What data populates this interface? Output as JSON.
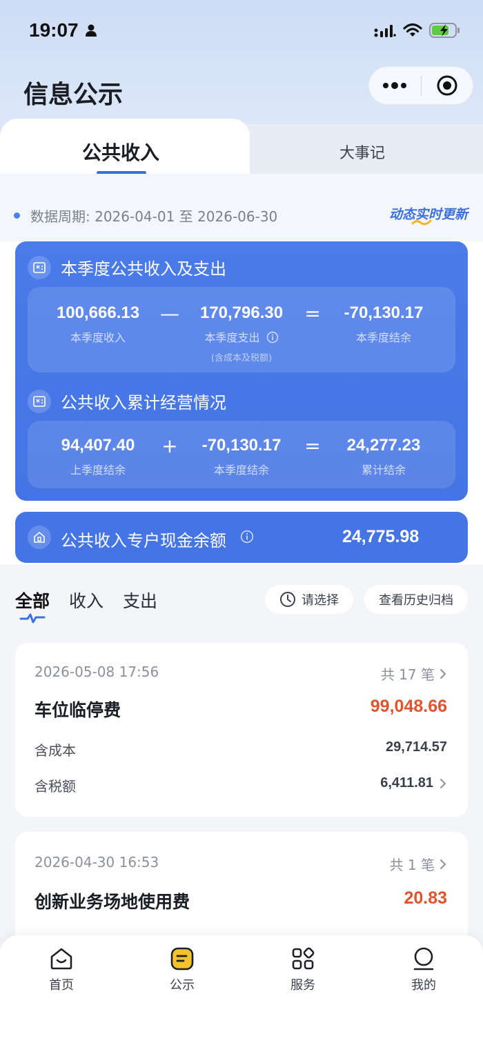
{
  "status_bar": {
    "time": "19:07"
  },
  "header": {
    "title": "信息公示"
  },
  "tabs": {
    "active": "公共收入",
    "inactive": "大事记"
  },
  "period": {
    "text": "数据周期: 2026-04-01 至 2026-06-30",
    "realtime": "动态实时更新"
  },
  "quarter_summary": {
    "title": "本季度公共收入及支出",
    "income": {
      "value": "100,666.13",
      "label": "本季度收入"
    },
    "op1": "—",
    "expense": {
      "value": "170,796.30",
      "label": "本季度支出",
      "sub": "(含成本及税额)"
    },
    "op2": "=",
    "balance": {
      "value": "-70,130.17",
      "label": "本季度结余"
    }
  },
  "cumulative": {
    "title": "公共收入累计经营情况",
    "prev": {
      "value": "94,407.40",
      "label": "上季度结余"
    },
    "op1": "+",
    "current": {
      "value": "-70,130.17",
      "label": "本季度结余"
    },
    "op2": "=",
    "total": {
      "value": "24,277.23",
      "label": "累计结余"
    }
  },
  "cash": {
    "label": "公共收入专户现金余额",
    "value": "24,775.98"
  },
  "filters": {
    "tabs": [
      "全部",
      "收入",
      "支出"
    ],
    "select_label": "请选择",
    "history_label": "查看历史归档"
  },
  "records": [
    {
      "date": "2026-05-08 17:56",
      "count": "共 17 笔",
      "title": "车位临停费",
      "amount": "99,048.66",
      "cost_label": "含成本",
      "cost_value": "29,714.57",
      "tax_label": "含税额",
      "tax_value": "6,411.81"
    },
    {
      "date": "2026-04-30 16:53",
      "count": "共 1 笔",
      "title": "创新业务场地使用费",
      "amount": "20.83"
    }
  ],
  "bottom_nav": [
    {
      "label": "首页",
      "icon": "home-icon"
    },
    {
      "label": "公示",
      "icon": "notice-icon"
    },
    {
      "label": "服务",
      "icon": "grid-icon"
    },
    {
      "label": "我的",
      "icon": "profile-icon"
    }
  ],
  "colors": {
    "primary": "#4574e4",
    "accent_red": "#e0532b"
  }
}
